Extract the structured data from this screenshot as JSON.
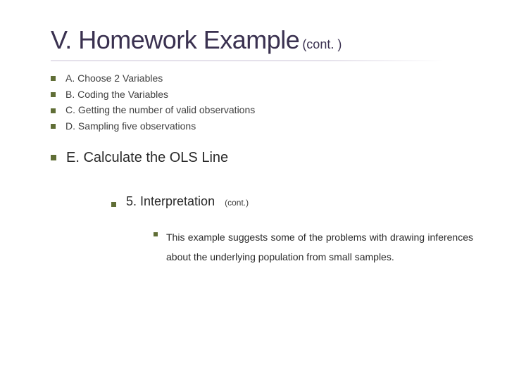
{
  "title": {
    "main": "V. Homework Example",
    "cont": "(cont. )"
  },
  "items": [
    "A. Choose 2 Variables",
    "B. Coding the Variables",
    "C. Getting the number of valid observations",
    "D. Sampling five observations"
  ],
  "emphasis": "E. Calculate the OLS Line",
  "sub": {
    "label": "5. Interpretation",
    "cont": "(cont.)"
  },
  "body": "This example suggests some of the problems with drawing inferences about the underlying population from small samples."
}
